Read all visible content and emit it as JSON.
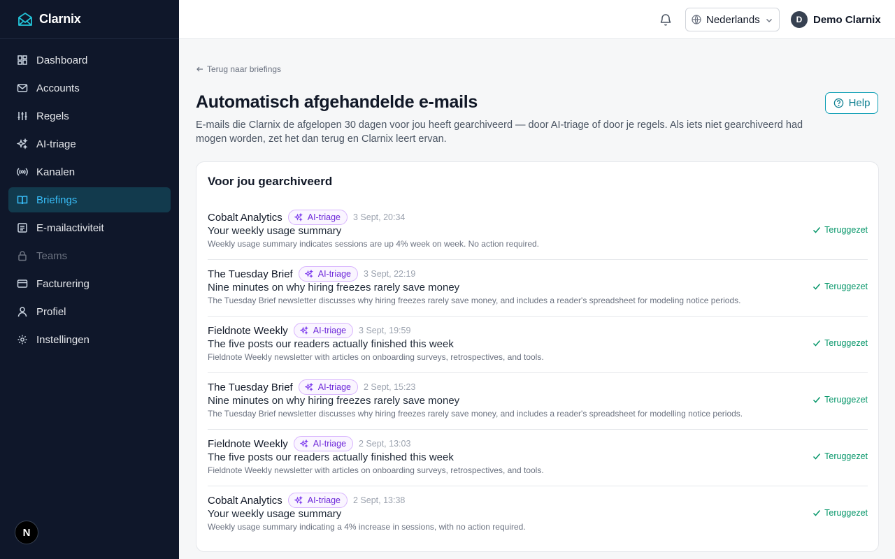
{
  "brand": {
    "name": "Clarnix"
  },
  "sidebar": {
    "items": [
      {
        "label": "Dashboard",
        "icon": "dashboard-icon"
      },
      {
        "label": "Accounts",
        "icon": "mail-icon"
      },
      {
        "label": "Regels",
        "icon": "sliders-icon"
      },
      {
        "label": "AI-triage",
        "icon": "sparkles-icon"
      },
      {
        "label": "Kanalen",
        "icon": "broadcast-icon"
      },
      {
        "label": "Briefings",
        "icon": "book-open-icon",
        "active": true
      },
      {
        "label": "E-mailactiviteit",
        "icon": "activity-list-icon"
      },
      {
        "label": "Teams",
        "icon": "lock-icon",
        "disabled": true
      },
      {
        "label": "Facturering",
        "icon": "credit-card-icon"
      },
      {
        "label": "Profiel",
        "icon": "user-icon"
      },
      {
        "label": "Instellingen",
        "icon": "gear-icon"
      }
    ],
    "bottom_avatar": "N"
  },
  "topbar": {
    "language": "Nederlands",
    "user": {
      "initial": "D",
      "name": "Demo Clarnix"
    }
  },
  "page": {
    "back_link": "Terug naar briefings",
    "title": "Automatisch afgehandelde e-mails",
    "help_label": "Help",
    "subtitle": "E-mails die Clarnix de afgelopen 30 dagen voor jou heeft gearchiveerd — door AI-triage of door je regels. Als iets niet gearchiveerd had mogen worden, zet het dan terug en Clarnix leert ervan.",
    "card_title": "Voor jou gearchiveerd"
  },
  "emails": [
    {
      "sender": "Cobalt Analytics",
      "badge": "AI-triage",
      "time": "3 Sept, 20:34",
      "subject": "Your weekly usage summary",
      "summary": "Weekly usage summary indicates sessions are up 4% week on week. No action required.",
      "status": "Teruggezet"
    },
    {
      "sender": "The Tuesday Brief",
      "badge": "AI-triage",
      "time": "3 Sept, 22:19",
      "subject": "Nine minutes on why hiring freezes rarely save money",
      "summary": "The Tuesday Brief newsletter discusses why hiring freezes rarely save money, and includes a reader's spreadsheet for modeling notice periods.",
      "status": "Teruggezet"
    },
    {
      "sender": "Fieldnote Weekly",
      "badge": "AI-triage",
      "time": "3 Sept, 19:59",
      "subject": "The five posts our readers actually finished this week",
      "summary": "Fieldnote Weekly newsletter with articles on onboarding surveys, retrospectives, and tools.",
      "status": "Teruggezet"
    },
    {
      "sender": "The Tuesday Brief",
      "badge": "AI-triage",
      "time": "2 Sept, 15:23",
      "subject": "Nine minutes on why hiring freezes rarely save money",
      "summary": "The Tuesday Brief newsletter discusses why hiring freezes rarely save money, and includes a reader's spreadsheet for modelling notice periods.",
      "status": "Teruggezet"
    },
    {
      "sender": "Fieldnote Weekly",
      "badge": "AI-triage",
      "time": "2 Sept, 13:03",
      "subject": "The five posts our readers actually finished this week",
      "summary": "Fieldnote Weekly newsletter with articles on onboarding surveys, retrospectives, and tools.",
      "status": "Teruggezet"
    },
    {
      "sender": "Cobalt Analytics",
      "badge": "AI-triage",
      "time": "2 Sept, 13:38",
      "subject": "Your weekly usage summary",
      "summary": "Weekly usage summary indicating a 4% increase in sessions, with no action required.",
      "status": "Teruggezet"
    }
  ],
  "colors": {
    "sidebar_bg": "#0f172a",
    "active_bg": "#123a4d",
    "active_text": "#38bdf8",
    "badge_text": "#6d28d9",
    "restored_text": "#059669",
    "accent": "#0e9fb5"
  }
}
